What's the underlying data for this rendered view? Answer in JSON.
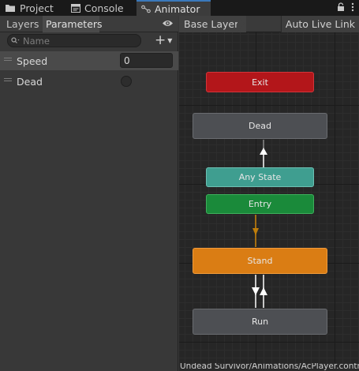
{
  "tabs": [
    {
      "label": "Project",
      "icon": "folder-icon"
    },
    {
      "label": "Console",
      "icon": "console-icon"
    },
    {
      "label": "Animator",
      "icon": "animator-icon",
      "active": true
    }
  ],
  "left_panel": {
    "tabs": [
      "Layers",
      "Parameters"
    ],
    "active_tab": "Parameters",
    "search": {
      "placeholder": "Name",
      "value": ""
    },
    "add_label": "+",
    "parameters": [
      {
        "name": "Speed",
        "type": "float",
        "value": "0"
      },
      {
        "name": "Dead",
        "type": "bool",
        "value": false
      }
    ]
  },
  "graph": {
    "breadcrumb": "Base Layer",
    "auto_live_link": "Auto Live Link",
    "states": {
      "exit": "Exit",
      "dead": "Dead",
      "anystate": "Any State",
      "entry": "Entry",
      "stand": "Stand",
      "run": "Run"
    },
    "status_path": "Undead Survivor/Animations/AcPlayer.controlle",
    "colors": {
      "exit": "#b3161a",
      "anystate": "#3f9e90",
      "entry": "#1a8a3a",
      "default_state": "#da7d14",
      "state": "#4d4f53",
      "tab_accent": "#3a79bb"
    }
  }
}
